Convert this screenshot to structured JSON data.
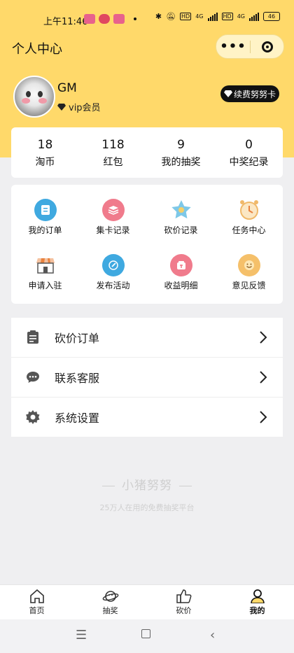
{
  "status": {
    "time": "上午11:46",
    "network_a": "4G",
    "network_b": "4G",
    "hd": "HD",
    "battery": "46"
  },
  "nav": {
    "title": "个人中心",
    "more": "•••"
  },
  "profile": {
    "name": "GM",
    "vip": "vip会员",
    "renew": "续费努努卡"
  },
  "stats": [
    {
      "value": "18",
      "label": "淘币"
    },
    {
      "value": "118",
      "label": "红包"
    },
    {
      "value": "9",
      "label": "我的抽奖"
    },
    {
      "value": "0",
      "label": "中奖纪录"
    }
  ],
  "grid": [
    {
      "label": "我的订单",
      "icon": "order-icon",
      "color": "#3fa9e0"
    },
    {
      "label": "集卡记录",
      "icon": "card-icon",
      "color": "#f07b8c"
    },
    {
      "label": "砍价记录",
      "icon": "star-icon",
      "color": "#7ec8e8"
    },
    {
      "label": "任务中心",
      "icon": "clock-icon",
      "color": "#f0b96a"
    },
    {
      "label": "申请入驻",
      "icon": "shop-icon",
      "color": "#e9823e"
    },
    {
      "label": "发布活动",
      "icon": "pen-icon",
      "color": "#3fa9e0"
    },
    {
      "label": "收益明细",
      "icon": "wallet-icon",
      "color": "#f07b8c"
    },
    {
      "label": "意见反馈",
      "icon": "smile-icon",
      "color": "#f5c06a"
    }
  ],
  "list": [
    {
      "label": "砍价订单",
      "icon": "clipboard-icon"
    },
    {
      "label": "联系客服",
      "icon": "chat-icon"
    },
    {
      "label": "系统设置",
      "icon": "gear-icon"
    }
  ],
  "footer": {
    "slogan": "小猪努努",
    "sub": "25万人在用的免费抽奖平台"
  },
  "tabs": [
    {
      "label": "首页",
      "icon": "home-icon"
    },
    {
      "label": "抽奖",
      "icon": "planet-icon"
    },
    {
      "label": "砍价",
      "icon": "thumb-icon"
    },
    {
      "label": "我的",
      "icon": "user-icon"
    }
  ],
  "colors": {
    "brand_yellow": "#ffd96a",
    "background": "#efeff1"
  }
}
